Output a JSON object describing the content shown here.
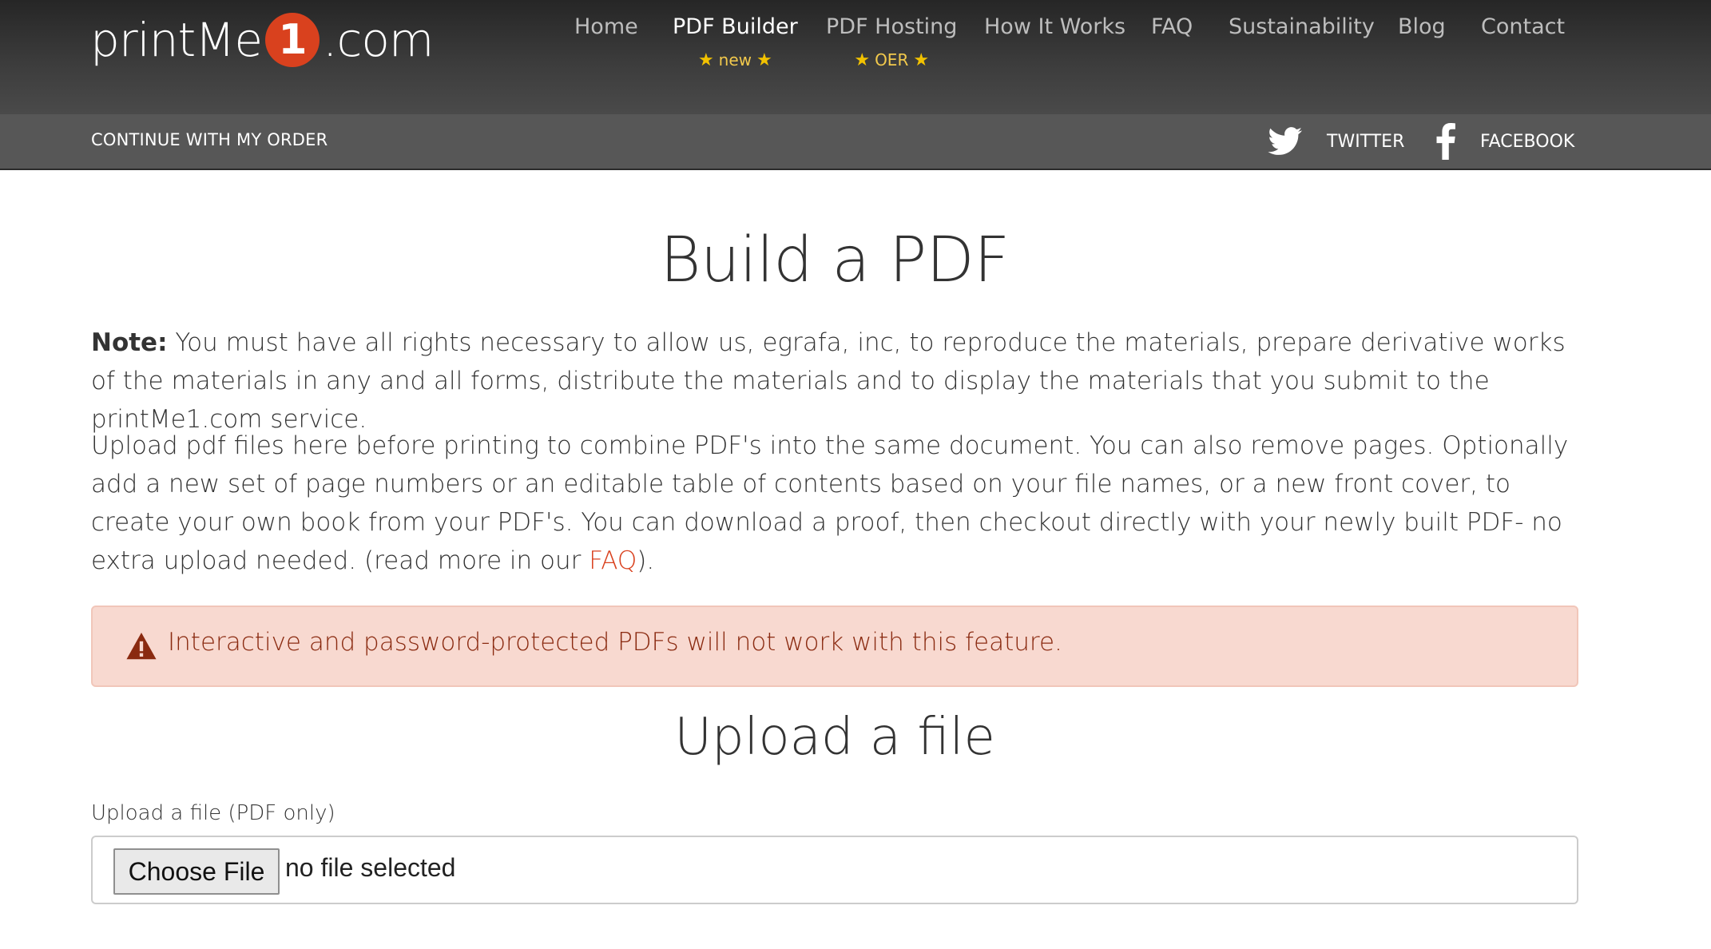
{
  "brand": {
    "logo_prefix": "printMe",
    "logo_digit": "1",
    "logo_suffix": ".com",
    "accent_color": "#d9411e"
  },
  "nav": {
    "items": [
      {
        "label": "Home"
      },
      {
        "label": "PDF Builder",
        "badge": "new",
        "active": true
      },
      {
        "label": "PDF Hosting",
        "badge": "OER"
      },
      {
        "label": "How It Works"
      },
      {
        "label": "FAQ"
      },
      {
        "label": "Sustainability"
      },
      {
        "label": "Blog"
      },
      {
        "label": "Contact"
      }
    ],
    "star_icon": "star-icon"
  },
  "subbar": {
    "continue_label": "CONTINUE WITH MY ORDER",
    "twitter_label": "TWITTER",
    "facebook_label": "FACEBOOK"
  },
  "main": {
    "title": "Build a PDF",
    "note_label": "Note:",
    "note_text": " You must have all rights necessary to allow us, egrafa, inc, to reproduce the materials, prepare derivative works of the materials in any and all forms, distribute the materials and to display the materials that you submit to the printMe1.com service.",
    "intro_text": "Upload pdf files here before printing to combine PDF's into the same document. You can also remove pages. Optionally add a new set of page numbers or an editable table of contents based on your file names, or a new front cover, to create your own book from your PDF's. You can download a proof, then checkout directly with your newly built PDF- no extra upload needed. (read more in our ",
    "faq_link": "FAQ",
    "intro_end": ").",
    "alert_text": "Interactive and password-protected PDFs will not work with this feature.",
    "alert_color": "#f8d9d0",
    "upload_title": "Upload a file",
    "upload_label": "Upload a file (PDF only)",
    "choose_button": "Choose File",
    "file_status": "no file selected"
  }
}
